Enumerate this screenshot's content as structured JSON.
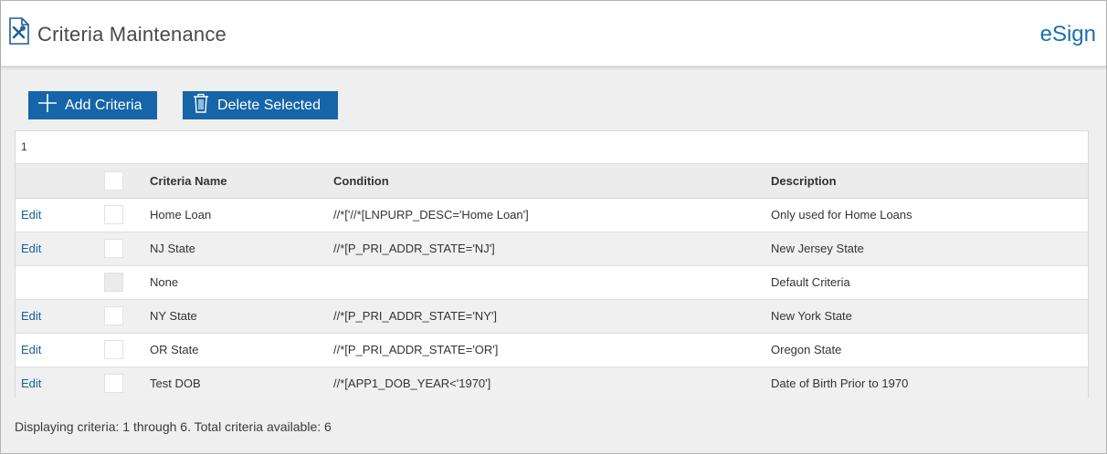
{
  "header": {
    "title": "Criteria Maintenance",
    "brand": "eSign",
    "page_icon": "document-tools-icon"
  },
  "toolbar": {
    "add_label": "Add Criteria",
    "add_icon": "plus-icon",
    "delete_label": "Delete Selected",
    "delete_icon": "trash-icon"
  },
  "pager": {
    "page": "1"
  },
  "table": {
    "columns": [
      "",
      "",
      "Criteria Name",
      "Condition",
      "Description"
    ],
    "rows": [
      {
        "edit": "Edit",
        "name": "Home Loan",
        "condition": "//*['//*[LNPURP_DESC='Home Loan']",
        "description": "Only used for Home Loans",
        "editable": true
      },
      {
        "edit": "Edit",
        "name": "NJ State",
        "condition": "//*[P_PRI_ADDR_STATE='NJ']",
        "description": "New Jersey State",
        "editable": true
      },
      {
        "edit": "",
        "name": "None",
        "condition": "",
        "description": "Default Criteria",
        "editable": false
      },
      {
        "edit": "Edit",
        "name": "NY State",
        "condition": "//*[P_PRI_ADDR_STATE='NY']",
        "description": "New York State",
        "editable": true
      },
      {
        "edit": "Edit",
        "name": "OR State",
        "condition": "//*[P_PRI_ADDR_STATE='OR']",
        "description": "Oregon State",
        "editable": true
      },
      {
        "edit": "Edit",
        "name": "Test DOB",
        "condition": "//*[APP1_DOB_YEAR<'1970']",
        "description": "Date of Birth Prior to 1970",
        "editable": true
      }
    ]
  },
  "footer": {
    "status": "Displaying criteria: 1 through 6. Total criteria available: 6"
  },
  "colors": {
    "accent": "#1565a8",
    "brand": "#1a6fb3",
    "link": "#1a5d9b",
    "background": "#efefef"
  }
}
